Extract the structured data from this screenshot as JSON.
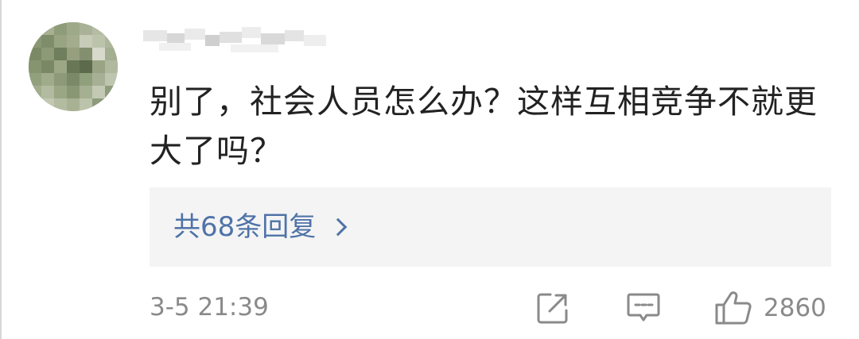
{
  "comment": {
    "text": "别了，社会人员怎么办？这样互相竞争不就更大了吗？",
    "timestamp": "3-5 21:39",
    "likes": "2860"
  },
  "replies": {
    "label": "共68条回复"
  },
  "icons": {
    "share": "share-icon",
    "comment": "comment-icon",
    "like": "thumbs-up-icon",
    "chevron": "chevron-right-icon"
  },
  "colors": {
    "link": "#4f73a8",
    "meta": "#8a8a8a",
    "text": "#222222",
    "reply_bg": "#f4f4f4"
  }
}
